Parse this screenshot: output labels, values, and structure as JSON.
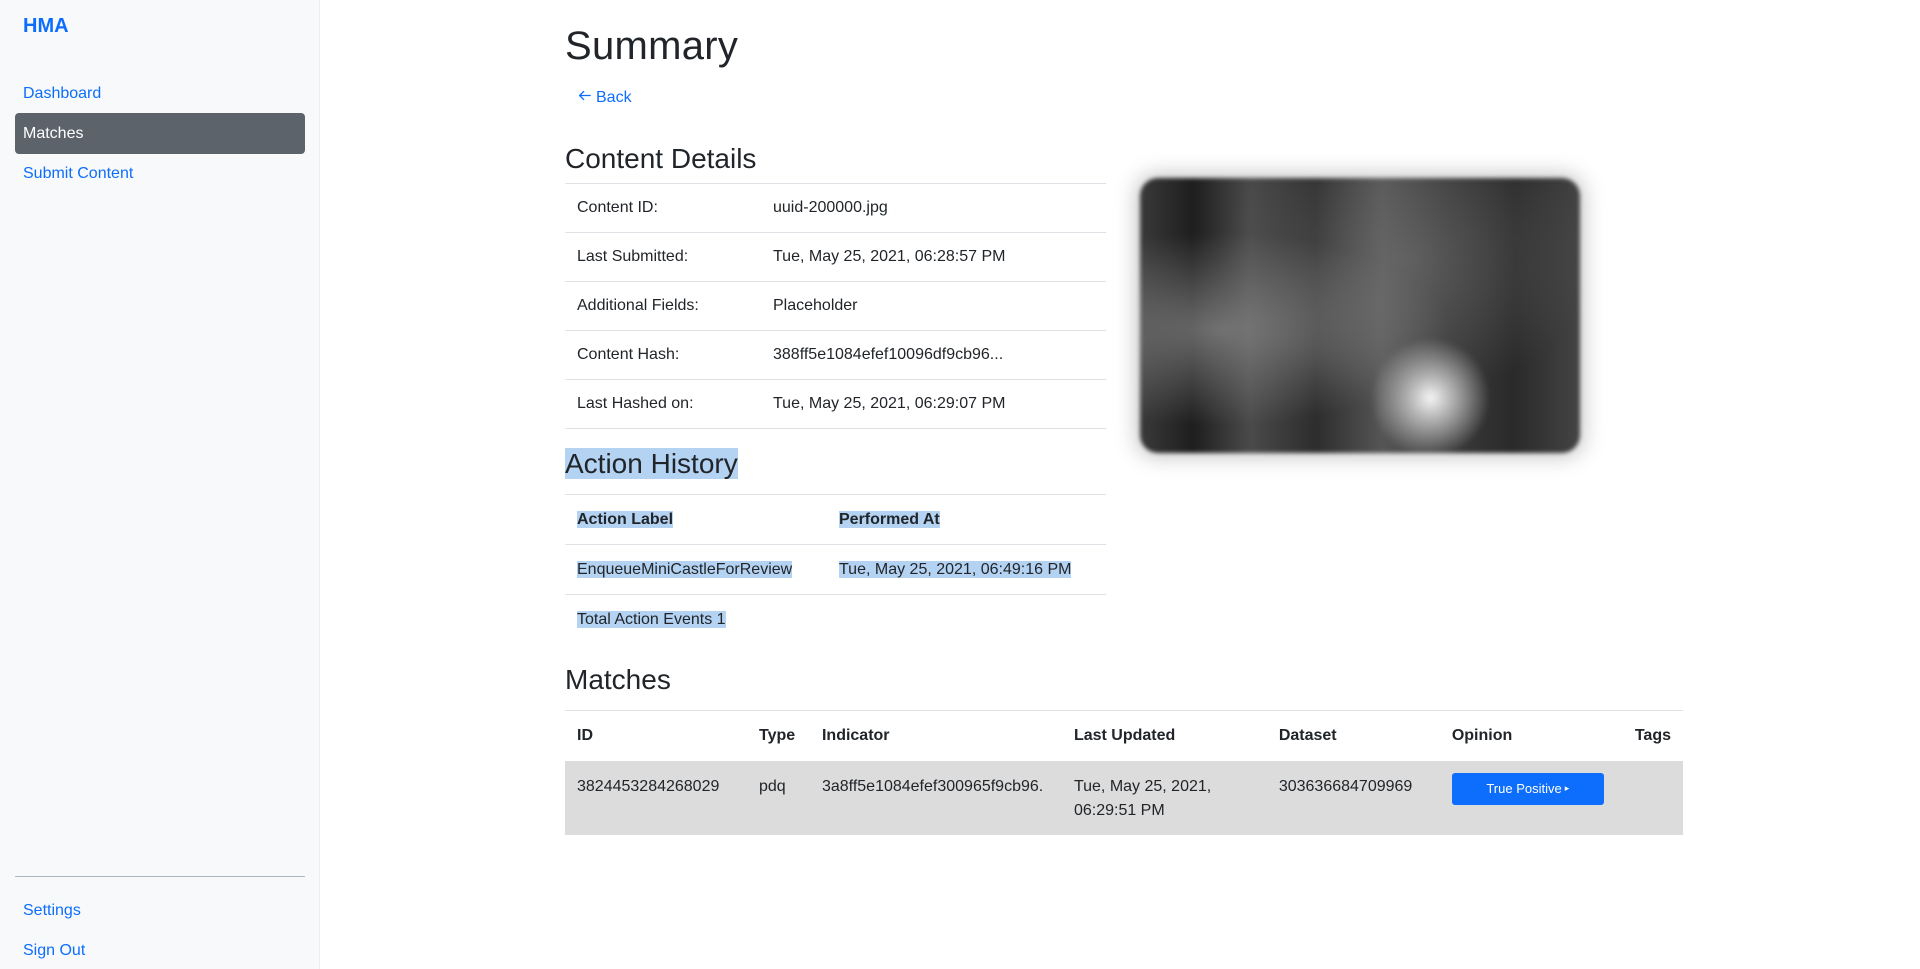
{
  "sidebar": {
    "brand": "HMA",
    "nav": [
      {
        "label": "Dashboard",
        "active": false
      },
      {
        "label": "Matches",
        "active": true
      },
      {
        "label": "Submit Content",
        "active": false
      }
    ],
    "bottom": [
      {
        "label": "Settings"
      },
      {
        "label": "Sign Out"
      }
    ]
  },
  "main": {
    "title": "Summary",
    "back": {
      "icon": "arrow-left-icon",
      "label": "Back"
    },
    "content_details": {
      "title": "Content Details",
      "rows": [
        {
          "key": "Content ID:",
          "value": "uuid-200000.jpg"
        },
        {
          "key": "Last Submitted:",
          "value": "Tue, May 25, 2021, 06:28:57 PM"
        },
        {
          "key": "Additional Fields:",
          "value": "Placeholder"
        },
        {
          "key": "Content Hash:",
          "value": "388ff5e1084efef10096df9cb96..."
        },
        {
          "key": "Last Hashed on:",
          "value": "Tue, May 25, 2021, 06:29:07 PM"
        }
      ]
    },
    "action_history": {
      "title": "Action History",
      "headers": [
        "Action Label",
        "Performed At"
      ],
      "rows": [
        {
          "label": "EnqueueMiniCastleForReview",
          "performed_at": "Tue, May 25, 2021, 06:49:16 PM"
        }
      ],
      "total": "Total Action Events 1"
    },
    "matches": {
      "title": "Matches",
      "headers": [
        "ID",
        "Type",
        "Indicator",
        "Last Updated",
        "Dataset",
        "Opinion",
        "Tags"
      ],
      "rows": [
        {
          "id": "3824453284268029",
          "type": "pdq",
          "indicator": "3a8ff5e1084efef300965f9cb96.",
          "last_updated": "Tue, May 25, 2021, 06:29:51 PM",
          "dataset": "303636684709969",
          "opinion": "True Positive",
          "tags": ""
        }
      ]
    }
  },
  "colors": {
    "accent": "#0d6efd",
    "active_nav": "#5c636a",
    "selection": "#b4d3f2",
    "match_row": "#dcdcdc"
  }
}
